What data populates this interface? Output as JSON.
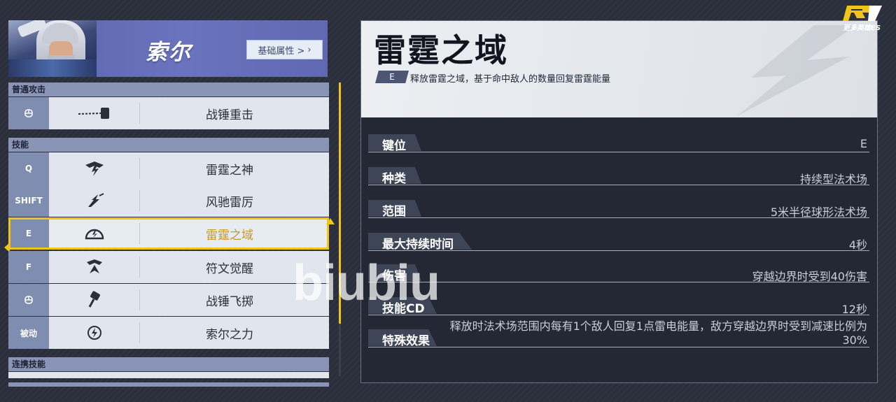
{
  "hero": {
    "name": "索尔",
    "attributes_button": "基础属性 > "
  },
  "sections": {
    "basic_attack": "普通攻击",
    "skills": "技能",
    "combo": "连携技能"
  },
  "basic_attack": {
    "key": "",
    "name": "战锤重击"
  },
  "skills": [
    {
      "key": "Q",
      "name": "雷霆之神"
    },
    {
      "key": "SHIFT",
      "name": "风驰雷厉"
    },
    {
      "key": "E",
      "name": "雷霆之域",
      "selected": true
    },
    {
      "key": "F",
      "name": "符文觉醒"
    },
    {
      "key": "",
      "name": "战锤飞掷"
    },
    {
      "key": "被动",
      "name": "索尔之力"
    }
  ],
  "detail": {
    "title": "雷霆之域",
    "key_badge": "E",
    "description": "释放雷霆之域，基于命中敌人的数量回复雷霆能量",
    "stats": [
      {
        "label": "键位",
        "value": "E"
      },
      {
        "label": "种类",
        "value": "持续型法术场"
      },
      {
        "label": "范围",
        "value": "5米半径球形法术场"
      },
      {
        "label": "最大持续时间",
        "value": "4秒"
      },
      {
        "label": "伤害",
        "value": "穿越边界时受到40伤害"
      },
      {
        "label": "技能CD",
        "value": "12秒"
      },
      {
        "label": "特殊效果",
        "value": "释放时法术场范围内每有1个敌人回复1点雷电能量，敌方穿越边界时受到减速比例为30%"
      }
    ]
  },
  "watermark": "biubiu",
  "logo_text": "更多英雄ES",
  "colors": {
    "accent": "#f0c419",
    "header_bg": "#6a74be",
    "selected_text": "#c7982a"
  }
}
